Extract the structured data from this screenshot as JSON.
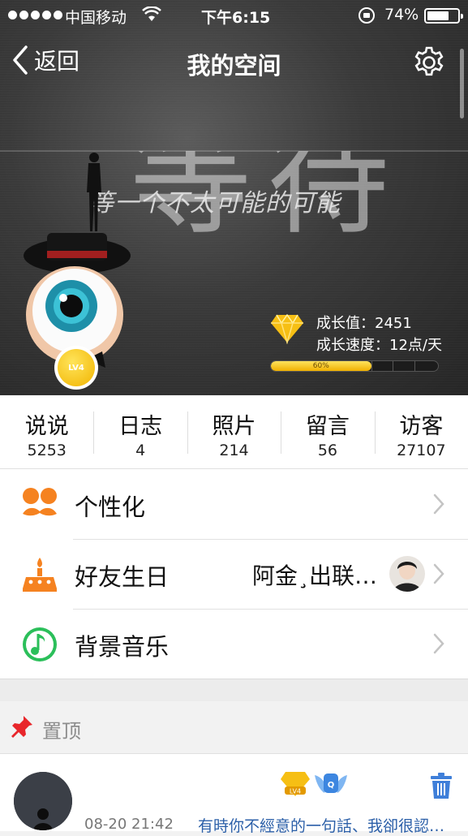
{
  "status_bar": {
    "carrier": "中国移动",
    "time": "下午6:15",
    "battery_percent": "74%",
    "battery_level": 0.74
  },
  "nav": {
    "back_label": "返回",
    "title": "我的空间",
    "settings_icon": "gear-icon"
  },
  "cover": {
    "big_text": "等待",
    "script_text": "等一个不太可能的可能"
  },
  "profile": {
    "level_badge": "LV4"
  },
  "growth": {
    "value_label": "成长值：2451",
    "speed_label": "成长速度：12点/天",
    "progress_text": "60%",
    "progress": 0.6
  },
  "stats": [
    {
      "label": "说说",
      "value": "5253"
    },
    {
      "label": "日志",
      "value": "4"
    },
    {
      "label": "照片",
      "value": "214"
    },
    {
      "label": "留言",
      "value": "56"
    },
    {
      "label": "访客",
      "value": "27107"
    }
  ],
  "menu": [
    {
      "label": "个性化",
      "icon": "mustache-icon",
      "extra": ""
    },
    {
      "label": "好友生日",
      "icon": "birthday-cake-icon",
      "extra": "阿金¸出联…"
    },
    {
      "label": "背景音乐",
      "icon": "music-note-icon",
      "extra": ""
    }
  ],
  "pinned": {
    "label": "置顶"
  },
  "post": {
    "time": "08-20 21:42",
    "text": "有時你不經意的一句話、我卻很認…"
  },
  "colors": {
    "accent_orange": "#f58220",
    "music_green": "#2bbf5a",
    "link_blue": "#2b5fa8",
    "gold": "#f3b600",
    "pin_red": "#e8262b"
  }
}
